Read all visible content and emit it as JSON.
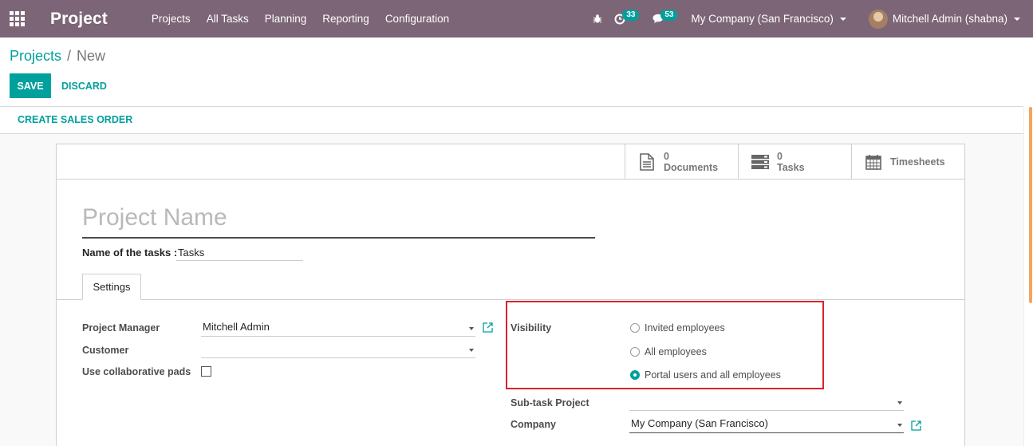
{
  "navbar": {
    "brand": "Project",
    "menu": [
      "Projects",
      "All Tasks",
      "Planning",
      "Reporting",
      "Configuration"
    ],
    "activity_count": "33",
    "messages_count": "53",
    "company": "My Company (San Francisco)",
    "user": "Mitchell Admin (shabna)",
    "color": "#7c6577"
  },
  "breadcrumb": {
    "parent": "Projects",
    "separator": "/",
    "current": "New"
  },
  "buttons": {
    "save": "SAVE",
    "discard": "DISCARD",
    "create_sales_order": "CREATE SALES ORDER"
  },
  "smart_buttons": {
    "documents": {
      "value": "0",
      "label": "Documents"
    },
    "tasks": {
      "value": "0",
      "label": "Tasks"
    },
    "timesheets": {
      "label": "Timesheets"
    }
  },
  "form": {
    "name_placeholder": "Project Name",
    "tasks_label": "Name of the tasks :",
    "tasks_value": "Tasks",
    "tab": "Settings",
    "project_manager_label": "Project Manager",
    "project_manager_value": "Mitchell Admin",
    "customer_label": "Customer",
    "customer_value": "",
    "collab_label": "Use collaborative pads",
    "collab_checked": false,
    "visibility_label": "Visibility",
    "visibility_options": [
      "Invited employees",
      "All employees",
      "Portal users and all employees"
    ],
    "visibility_selected": "Portal users and all employees",
    "subtask_label": "Sub-task Project",
    "subtask_value": "",
    "company_label": "Company",
    "company_value": "My Company (San Francisco)"
  },
  "colors": {
    "accent": "#00a09d",
    "highlight": "#d9232d"
  }
}
